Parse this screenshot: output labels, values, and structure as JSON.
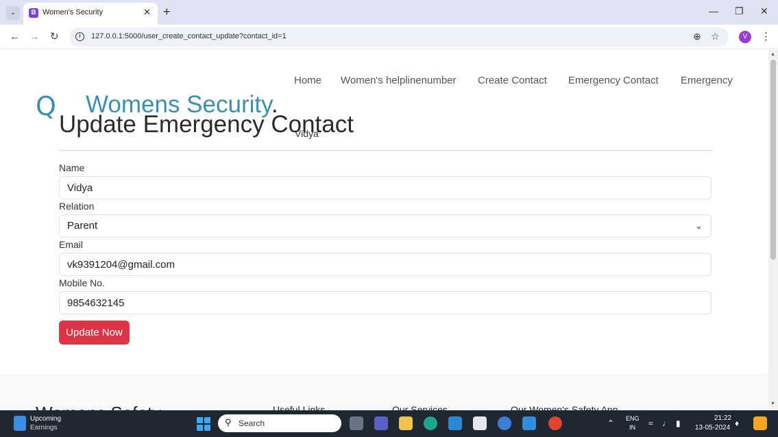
{
  "browser": {
    "tab_title": "Women's Security",
    "favicon_letter": "B",
    "url": "127.0.0.1:5000/user_create_contact_update?contact_id=1",
    "profile_initial": "V"
  },
  "nav": {
    "items": [
      "Home",
      "Women's helplinenumber",
      "Create Contact",
      "Emergency Contact",
      "Emergency"
    ]
  },
  "brand": {
    "q": "Q",
    "name": "Womens Security",
    "dot": "."
  },
  "page": {
    "title": "Update Emergency Contact",
    "username": "Vidya"
  },
  "form": {
    "name_label": "Name",
    "name_value": "Vidya",
    "relation_label": "Relation",
    "relation_value": "Parent",
    "email_label": "Email",
    "email_value": "vk9391204@gmail.com",
    "mobile_label": "Mobile No.",
    "mobile_value": "9854632145",
    "submit_label": "Update Now"
  },
  "footer": {
    "brand": "Womens Safety",
    "headings": [
      "Useful Links",
      "Our Services",
      "Our Women's Safety App"
    ]
  },
  "taskbar": {
    "widget_title": "Upcoming",
    "widget_subtitle": "Earnings",
    "search_placeholder": "Search",
    "lang_line1": "ENG",
    "lang_line2": "IN",
    "time": "21:22",
    "date": "13-05-2024"
  },
  "colors": {
    "brand": "#3b8fb0",
    "button": "#dc3545",
    "taskbar": "#1f2733"
  }
}
